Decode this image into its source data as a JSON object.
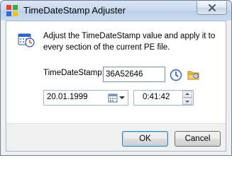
{
  "window": {
    "title": "TimeDateStamp Adjuster",
    "close_icon": "close-icon",
    "app_icon": "app-icon"
  },
  "description": "Adjust the TimeDateStamp value and apply it to every section of the current PE file.",
  "timedatestamp": {
    "label": "TimeDateStamp:",
    "value": "36A52646",
    "clock_icon": "clock-icon",
    "folder_icon": "folder-icon"
  },
  "date": {
    "value": "20.01.1999",
    "calendar_icon": "calendar-icon"
  },
  "time": {
    "value": "0:41:42"
  },
  "buttons": {
    "ok": "OK",
    "cancel": "Cancel"
  },
  "colors": {
    "titlebar": "#c7d8ee",
    "dialog_bg": "#f0f0f0",
    "ok_border": "#3c7fb1"
  }
}
